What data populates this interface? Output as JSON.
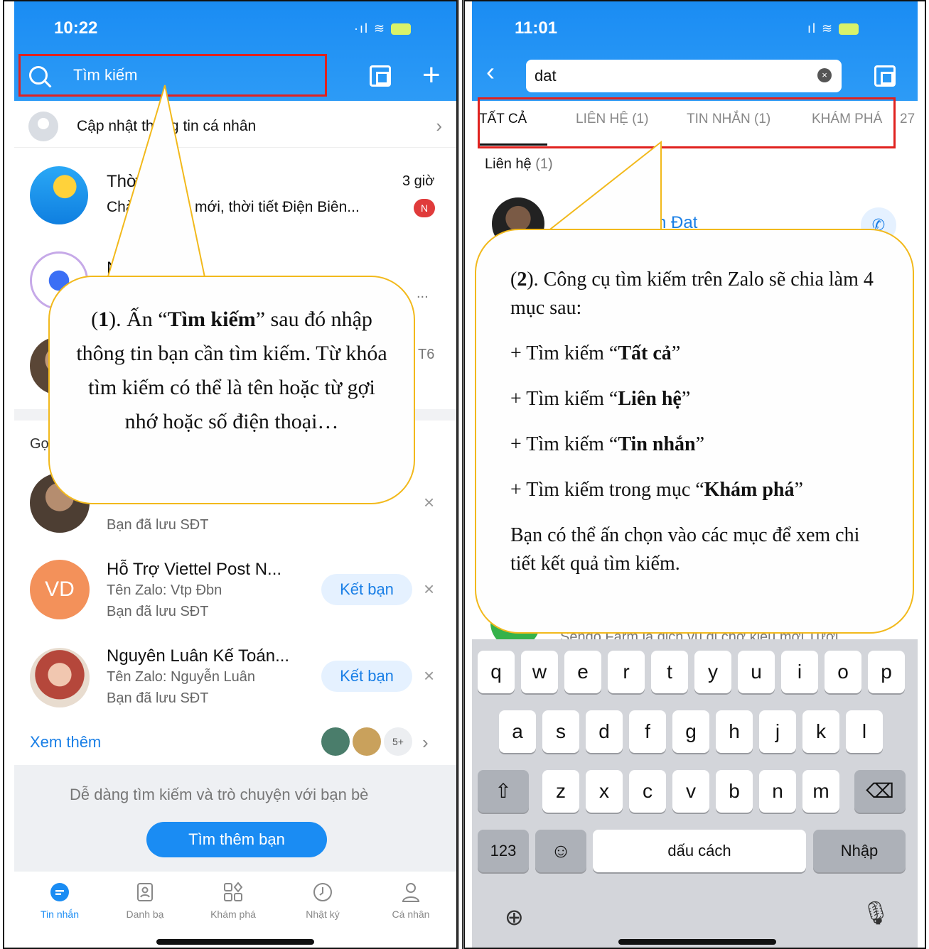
{
  "left_screen": {
    "status_time": "10:22",
    "search_placeholder": "Tìm kiếm",
    "update_profile": "Cập nhật thông tin cá nhân",
    "chats": [
      {
        "title": "Thờ",
        "preview": "Chào",
        "preview_tail": "mới, thời tiết Điện Biên...",
        "time": "3 giờ",
        "badge": "N"
      },
      {
        "title": "N",
        "time": "...",
        "preview": ""
      },
      {
        "time": "T6"
      }
    ],
    "suggest_label": "Gợ",
    "suggestions": [
      {
        "initials": "",
        "name": "",
        "zalo": "",
        "saved": "Bạn đã lưu SĐT"
      },
      {
        "initials": "VD",
        "name": "Hỗ Trợ Viettel Post N...",
        "zalo": "Tên Zalo: Vtp Đbn",
        "saved": "Bạn đã lưu SĐT",
        "action": "Kết bạn"
      },
      {
        "initials": "",
        "name": "Nguyên Luân Kế Toán...",
        "zalo": "Tên Zalo: Nguyễn Luân",
        "saved": "Bạn đã lưu SĐT",
        "action": "Kết bạn"
      }
    ],
    "see_more": "Xem thêm",
    "see_more_count": "5+",
    "find_hint": "Dễ dàng tìm kiếm và trò chuyện với bạn bè",
    "find_button": "Tìm thêm bạn",
    "tabs": [
      "Tin nhắn",
      "Danh bạ",
      "Khám phá",
      "Nhật ký",
      "Cá nhân"
    ],
    "callout": {
      "p1": "(",
      "num": "1",
      "p2": "). Ấn “",
      "bold": "Tìm kiếm",
      "p3": "” sau đó nhập thông tin bạn cần tìm kiếm. Từ khóa tìm kiếm có thể là tên hoặc từ gợi nhớ hoặc số điện thoại…"
    }
  },
  "right_screen": {
    "status_time": "11:01",
    "search_value": "dat",
    "tabs": [
      "TẤT CẢ",
      "LIÊN HỆ (1)",
      "TIN NHẮN (1)",
      "KHÁM PHÁ",
      "27"
    ],
    "section_label": "Liên hệ",
    "section_count": "(1)",
    "contact_name_partial": "n Đạt",
    "behind_text": "Sendo Farm là dịch vụ đi chợ kiểu mới Tươi",
    "callout": {
      "intro_a": "(",
      "intro_num": "2",
      "intro_b": "). Công cụ tìm kiếm trên Zalo sẽ chia làm 4 mục sau:",
      "items": [
        {
          "prefix": "+ Tìm kiếm “",
          "bold": "Tất cả",
          "suffix": "”"
        },
        {
          "prefix": "+ Tìm kiếm  “",
          "bold": "Liên hệ",
          "suffix": "”"
        },
        {
          "prefix": "+ Tìm kiếm “",
          "bold": "Tin nhắn",
          "suffix": "”"
        },
        {
          "prefix": "+ Tìm kiếm trong mục “",
          "bold": "Khám phá",
          "suffix": "”"
        }
      ],
      "closing": "Bạn có thể ấn chọn vào các mục để xem chi tiết kết quả tìm kiếm."
    },
    "keyboard": {
      "row1": [
        "q",
        "w",
        "e",
        "r",
        "t",
        "y",
        "u",
        "i",
        "o",
        "p"
      ],
      "row2": [
        "a",
        "s",
        "d",
        "f",
        "g",
        "h",
        "j",
        "k",
        "l"
      ],
      "row3": [
        "z",
        "x",
        "c",
        "v",
        "b",
        "n",
        "m"
      ],
      "numbers": "123",
      "space": "dấu cách",
      "enter": "Nhập"
    }
  },
  "colors": {
    "zalo_blue": "#1a8cf3",
    "highlight_red": "#e0221f",
    "callout_border": "#f2b91c"
  }
}
